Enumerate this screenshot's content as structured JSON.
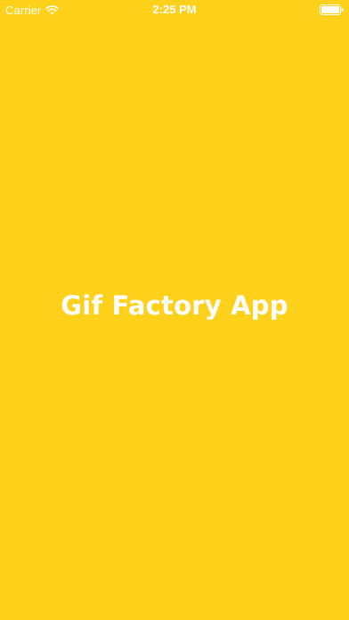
{
  "status_bar": {
    "carrier": "Carrier",
    "time": "2:25 PM",
    "icons": {
      "signal": "wifi-icon",
      "battery": "battery-icon"
    }
  },
  "splash": {
    "title": "Gif Factory App"
  },
  "colors": {
    "background": "#FFD11A",
    "text": "#FFFFFF"
  }
}
